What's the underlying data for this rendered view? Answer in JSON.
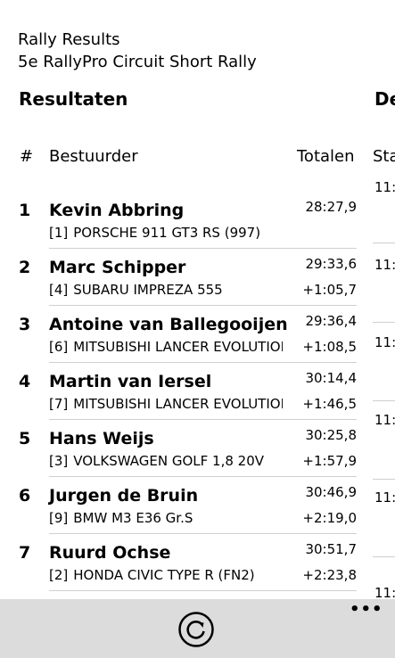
{
  "app": {
    "title": "Rally Results",
    "subtitle": "5e RallyPro Circuit Short Rally"
  },
  "pivot": {
    "active_header": "Resultaten",
    "next_header": "De"
  },
  "results": {
    "columns": {
      "pos": "#",
      "driver": "Bestuurder",
      "total": "Totalen"
    },
    "rows": [
      {
        "pos": "1",
        "driver": "Kevin Abbring",
        "num": "[1]",
        "car": "PORSCHE 911 GT3 RS (997)",
        "total": "28:27,9",
        "diff": ""
      },
      {
        "pos": "2",
        "driver": "Marc Schipper",
        "num": "[4]",
        "car": "SUBARU IMPREZA 555",
        "total": "29:33,6",
        "diff": "+1:05,7"
      },
      {
        "pos": "3",
        "driver": "Antoine van Ballegooijen",
        "num": "[6]",
        "car": "MITSUBISHI LANCER EVOLUTION",
        "total": "29:36,4",
        "diff": "+1:08,5"
      },
      {
        "pos": "4",
        "driver": "Martin van Iersel",
        "num": "[7]",
        "car": "MITSUBISHI LANCER EVOLUTION",
        "total": "30:14,4",
        "diff": "+1:46,5"
      },
      {
        "pos": "5",
        "driver": "Hans Weijs",
        "num": "[3]",
        "car": "VOLKSWAGEN GOLF 1,8 20V",
        "total": "30:25,8",
        "diff": "+1:57,9"
      },
      {
        "pos": "6",
        "driver": "Jurgen de Bruin",
        "num": "[9]",
        "car": "BMW M3 E36 Gr.S",
        "total": "30:46,9",
        "diff": "+2:19,0"
      },
      {
        "pos": "7",
        "driver": "Ruurd Ochse",
        "num": "[2]",
        "car": "HONDA CIVIC TYPE R (FN2)",
        "total": "30:51,7",
        "diff": "+2:23,8"
      }
    ]
  },
  "second_pivot": {
    "column_header": "Sta",
    "times": [
      "11:",
      "11:",
      "11:",
      "11:",
      "11:",
      "11:"
    ]
  },
  "appbar": {
    "refresh_icon": "refresh-icon",
    "more_label": "•••",
    "background": "#dcdcdc"
  }
}
